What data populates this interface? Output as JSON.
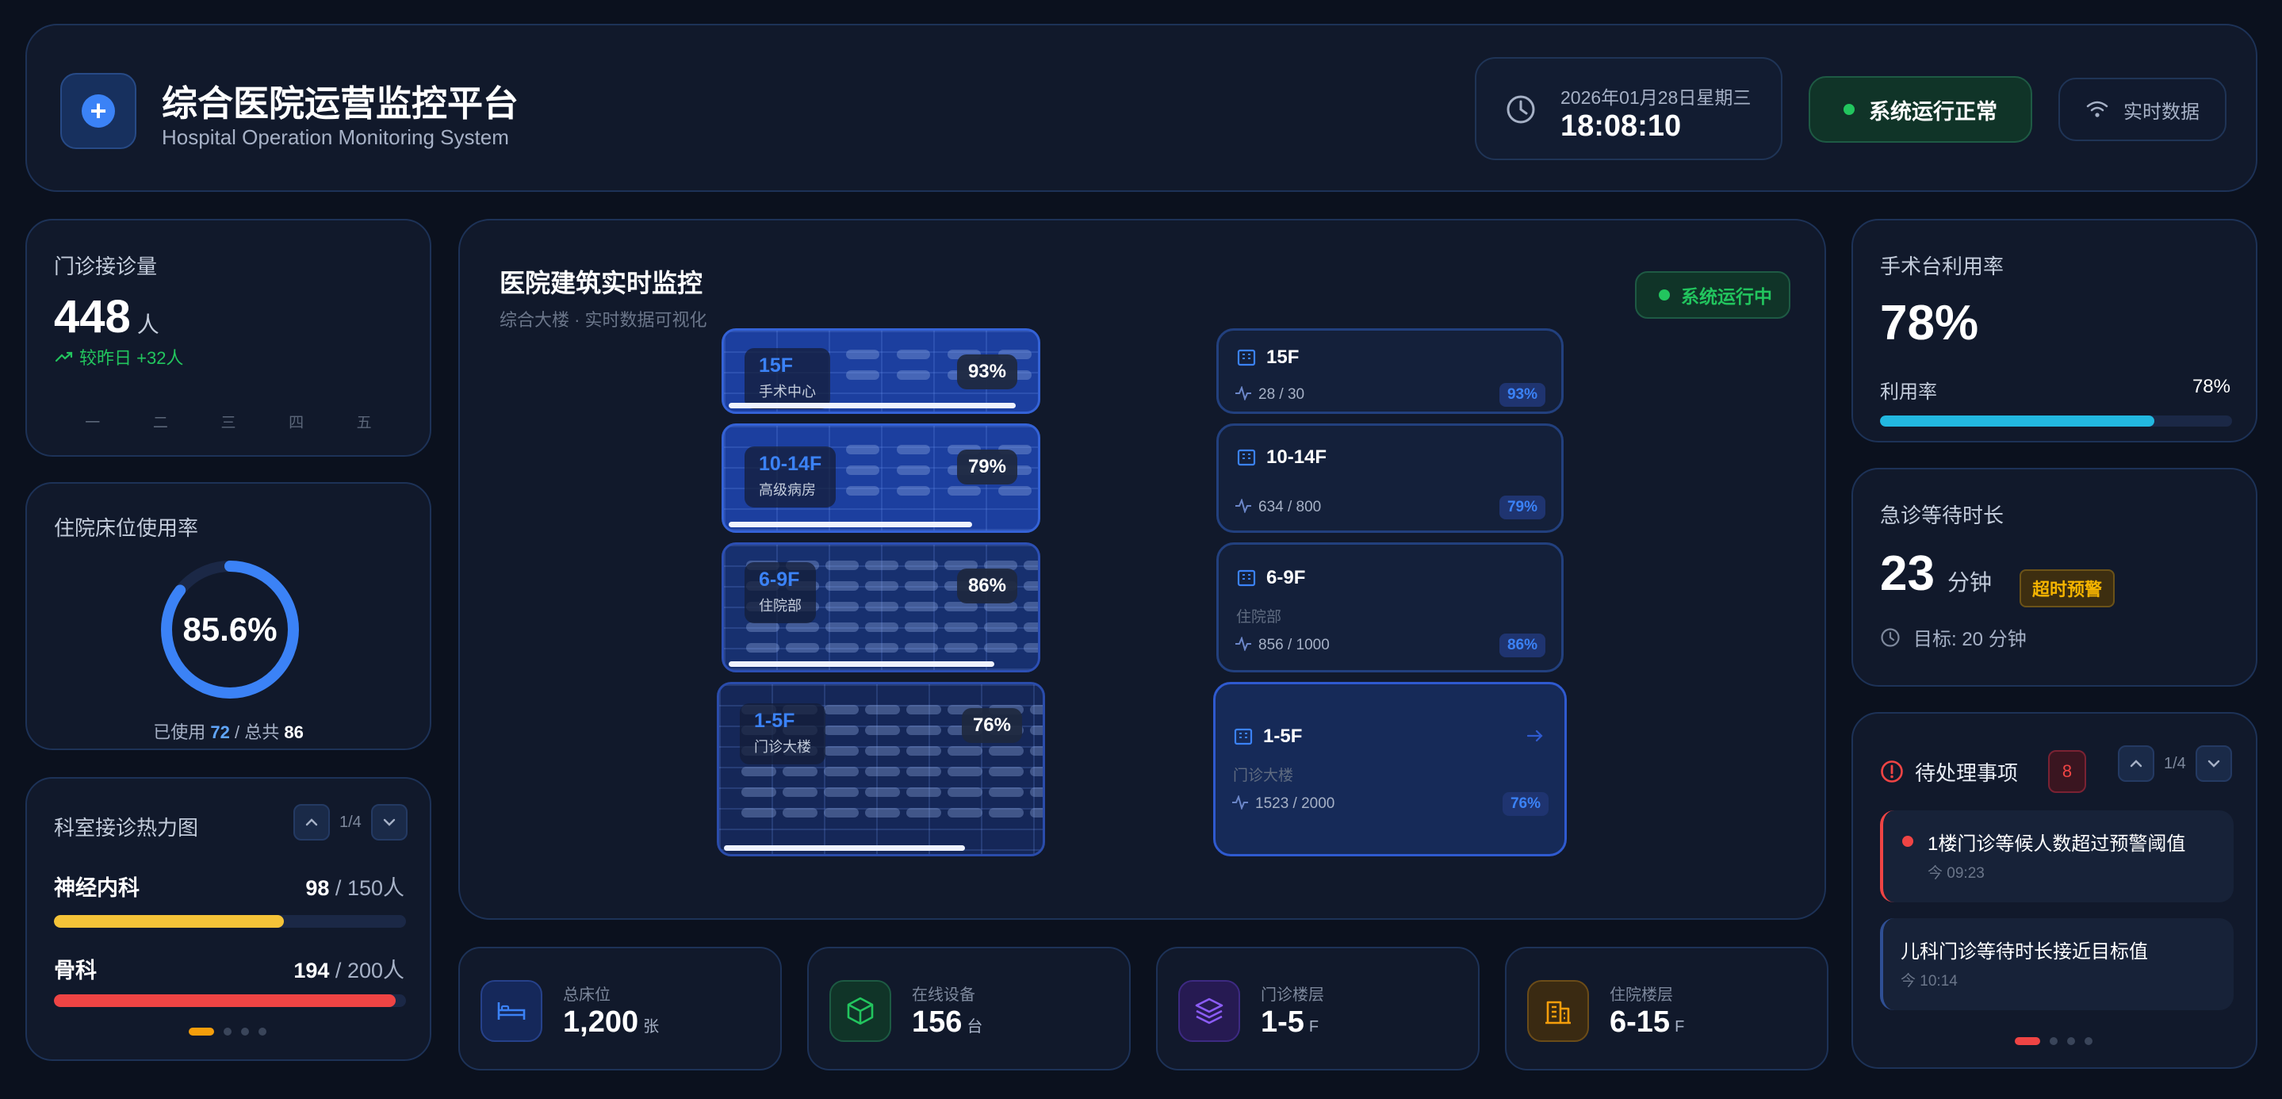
{
  "header": {
    "title": "综合医院运营监控平台",
    "subtitle": "Hospital Operation Monitoring System",
    "date": "2026年01月28日星期三",
    "time": "18:08:10",
    "status": "系统运行正常",
    "live_label": "实时数据"
  },
  "outpatient": {
    "title": "门诊接诊量",
    "value": "448",
    "unit": "人",
    "trend": "较昨日 +32人",
    "days": [
      "一",
      "二",
      "三",
      "四",
      "五"
    ]
  },
  "bed": {
    "title": "住院床位使用率",
    "rate": "85.6%",
    "rate_fraction": 0.856,
    "used_label": "已使用",
    "used": "72",
    "sep": "/",
    "total_label": "总共",
    "total": "86"
  },
  "heatmap": {
    "title": "科室接诊热力图",
    "page": "1/4",
    "depts": [
      {
        "name": "神经内科",
        "value": "98",
        "cap": "150人",
        "fraction": 0.653,
        "color": "#f5c338"
      },
      {
        "name": "骨科",
        "value": "194",
        "cap": "200人",
        "fraction": 0.97,
        "color": "#ef4444"
      }
    ],
    "dot_color": "#f59e0b"
  },
  "building": {
    "title": "医院建筑实时监控",
    "subtitle": "综合大楼 · 实时数据可视化",
    "status": "系统运行中",
    "floors": [
      {
        "name": "15F",
        "desc": "手术中心",
        "pct": "93%",
        "fraction": 0.93,
        "count": "28 / 30"
      },
      {
        "name": "10-14F",
        "desc": "高级病房",
        "pct": "79%",
        "fraction": 0.79,
        "count": "634 / 800"
      },
      {
        "name": "6-9F",
        "desc": "住院部",
        "pct": "86%",
        "fraction": 0.86,
        "count": "856 / 1000"
      },
      {
        "name": "1-5F",
        "desc": "门诊大楼",
        "pct": "76%",
        "fraction": 0.76,
        "count": "1523 / 2000"
      }
    ],
    "card_details": [
      {
        "name": "15F",
        "count": "28 / 30",
        "badge": "93%"
      },
      {
        "name": "10-14F",
        "count": "634 / 800",
        "badge": "79%"
      },
      {
        "name": "6-9F",
        "desc": "住院部",
        "count": "856 / 1000",
        "badge": "86%"
      },
      {
        "name": "1-5F",
        "desc": "门诊大楼",
        "count": "1523 / 2000",
        "badge": "76%"
      }
    ]
  },
  "stats": [
    {
      "label": "总床位",
      "value": "1,200",
      "unit": "张",
      "icon": "bed-icon",
      "color": "#3b82f6"
    },
    {
      "label": "在线设备",
      "value": "156",
      "unit": "台",
      "icon": "cube-icon",
      "color": "#22c55e"
    },
    {
      "label": "门诊楼层",
      "value": "1-5",
      "unit": "F",
      "icon": "layers-icon",
      "color": "#8b5cf6"
    },
    {
      "label": "住院楼层",
      "value": "6-15",
      "unit": "F",
      "icon": "building-icon",
      "color": "#f59e0b"
    }
  ],
  "surgery": {
    "title": "手术台利用率",
    "value": "78%",
    "label": "利用率",
    "pct": "78%",
    "fraction": 0.78
  },
  "er": {
    "title": "急诊等待时长",
    "value": "23",
    "unit": "分钟",
    "warning": "超时预警",
    "goal": "目标: 20 分钟"
  },
  "todo": {
    "title": "待处理事项",
    "count": "8",
    "page": "1/4",
    "items": [
      {
        "text": "1楼门诊等候人数超过预警阈值",
        "time": "今 09:23"
      },
      {
        "text": "儿科门诊等待时长接近目标值",
        "time": "今 10:14"
      }
    ],
    "dot_color": "#ef4444"
  }
}
